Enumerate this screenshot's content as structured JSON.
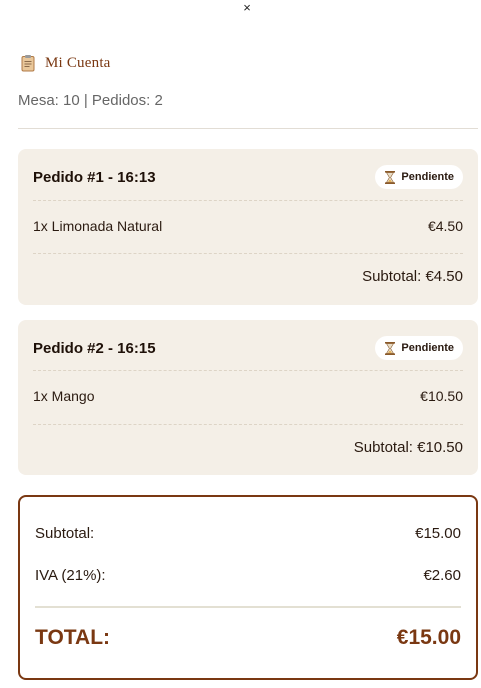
{
  "close_label": "×",
  "header": {
    "icon": "clipboard-icon",
    "title": "Mi Cuenta"
  },
  "meta": "Mesa: 10 | Pedidos: 2",
  "orders": [
    {
      "title": "Pedido #1 - 16:13",
      "status": "Pendiente",
      "status_icon": "hourglass-icon",
      "items": [
        {
          "label": "1x Limonada Natural",
          "price": "€4.50"
        }
      ],
      "subtotal": "Subtotal: €4.50"
    },
    {
      "title": "Pedido #2 - 16:15",
      "status": "Pendiente",
      "status_icon": "hourglass-icon",
      "items": [
        {
          "label": "1x Mango",
          "price": "€10.50"
        }
      ],
      "subtotal": "Subtotal: €10.50"
    }
  ],
  "totals": {
    "subtotal_label": "Subtotal:",
    "subtotal_value": "€15.00",
    "iva_label": "IVA (21%):",
    "iva_value": "€2.60",
    "total_label": "TOTAL:",
    "total_value": "€15.00"
  },
  "colors": {
    "accent": "#7a3812",
    "card_bg": "#f4efe7"
  }
}
